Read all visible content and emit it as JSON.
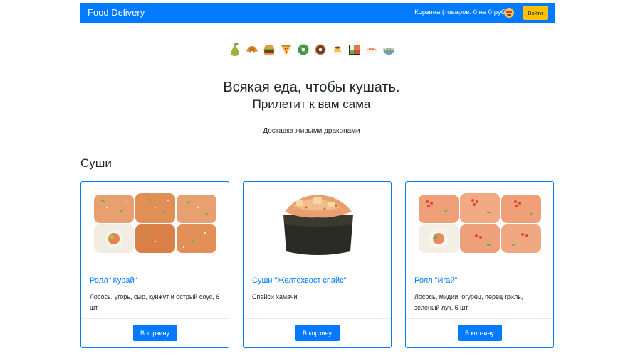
{
  "header": {
    "brand": "Food Delivery",
    "cart_text": "Корзина (товаров: 0 на 0 руб.)",
    "cart_emoji_icon": "heart-eyes-emoji-icon",
    "login_label": "Войти",
    "accent_color": "#007bff",
    "login_color": "#ffc107"
  },
  "food_icons": [
    "pear-icon",
    "croissant-icon",
    "hamburger-icon",
    "pizza-icon",
    "green-donut-icon",
    "donut-icon",
    "custard-icon",
    "bento-icon",
    "sushi-icon",
    "soup-icon"
  ],
  "hero": {
    "title": "Всякая еда, чтобы кушать.",
    "subtitle": "Прилетит к вам сама",
    "tagline": "Доставка живыми драконами"
  },
  "section_title": "Суши",
  "products": [
    {
      "name": "Ролл \"Курай\"",
      "description": "Лосось, угорь, сыр, кунжут и острый соус, 6 шт.",
      "button_label": "В корзину",
      "image_icon": "roll-kurai-image"
    },
    {
      "name": "Суши \"Желтохвост спайс\"",
      "description": "Спайси хамачи",
      "button_label": "В корзину",
      "image_icon": "sushi-yellowtail-image"
    },
    {
      "name": "Ролл \"Игай\"",
      "description": "Лосось, мидии, огурец, перец гриль, зеленый лук, 6 шт.",
      "button_label": "В корзину",
      "image_icon": "roll-igai-image"
    }
  ]
}
